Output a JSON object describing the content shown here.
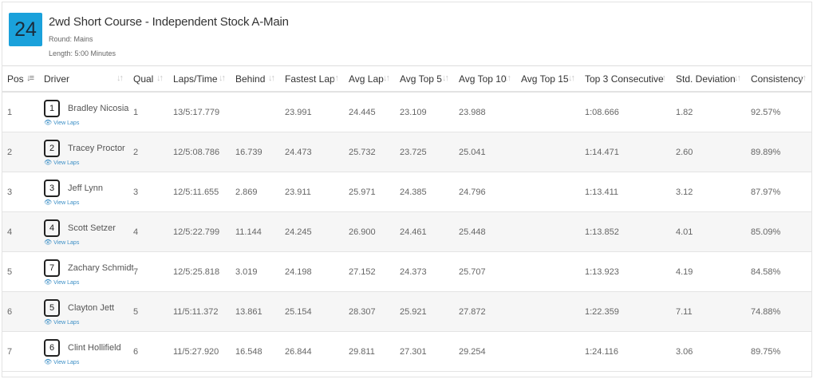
{
  "race": {
    "heat_number": "24",
    "title": "2wd Short Course - Independent Stock A-Main",
    "round": "Round: Mains",
    "length": "Length: 5:00 Minutes"
  },
  "columns": [
    "Pos",
    "Driver",
    "Qual",
    "Laps/Time",
    "Behind",
    "Fastest Lap",
    "Avg Lap",
    "Avg Top 5",
    "Avg Top 10",
    "Avg Top 15",
    "Top 3 Consecutive",
    "Std. Deviation",
    "Consistency"
  ],
  "view_laps_label": "View Laps",
  "rows": [
    {
      "pos": "1",
      "car": "1",
      "driver": "Bradley Nicosia",
      "qual": "1",
      "laps_time": "13/5:17.779",
      "behind": "",
      "fastest": "23.991",
      "avg": "24.445",
      "top5": "23.109",
      "top10": "23.988",
      "top15": "",
      "top3c": "1:08.666",
      "stddev": "1.82",
      "consistency": "92.57%"
    },
    {
      "pos": "2",
      "car": "2",
      "driver": "Tracey Proctor",
      "qual": "2",
      "laps_time": "12/5:08.786",
      "behind": "16.739",
      "fastest": "24.473",
      "avg": "25.732",
      "top5": "23.725",
      "top10": "25.041",
      "top15": "",
      "top3c": "1:14.471",
      "stddev": "2.60",
      "consistency": "89.89%"
    },
    {
      "pos": "3",
      "car": "3",
      "driver": "Jeff Lynn",
      "qual": "3",
      "laps_time": "12/5:11.655",
      "behind": "2.869",
      "fastest": "23.911",
      "avg": "25.971",
      "top5": "24.385",
      "top10": "24.796",
      "top15": "",
      "top3c": "1:13.411",
      "stddev": "3.12",
      "consistency": "87.97%"
    },
    {
      "pos": "4",
      "car": "4",
      "driver": "Scott Setzer",
      "qual": "4",
      "laps_time": "12/5:22.799",
      "behind": "11.144",
      "fastest": "24.245",
      "avg": "26.900",
      "top5": "24.461",
      "top10": "25.448",
      "top15": "",
      "top3c": "1:13.852",
      "stddev": "4.01",
      "consistency": "85.09%"
    },
    {
      "pos": "5",
      "car": "7",
      "driver": "Zachary Schmidt",
      "qual": "7",
      "laps_time": "12/5:25.818",
      "behind": "3.019",
      "fastest": "24.198",
      "avg": "27.152",
      "top5": "24.373",
      "top10": "25.707",
      "top15": "",
      "top3c": "1:13.923",
      "stddev": "4.19",
      "consistency": "84.58%"
    },
    {
      "pos": "6",
      "car": "5",
      "driver": "Clayton Jett",
      "qual": "5",
      "laps_time": "11/5:11.372",
      "behind": "13.861",
      "fastest": "25.154",
      "avg": "28.307",
      "top5": "25.921",
      "top10": "27.872",
      "top15": "",
      "top3c": "1:22.359",
      "stddev": "7.11",
      "consistency": "74.88%"
    },
    {
      "pos": "7",
      "car": "6",
      "driver": "Clint Hollifield",
      "qual": "6",
      "laps_time": "11/5:27.920",
      "behind": "16.548",
      "fastest": "26.844",
      "avg": "29.811",
      "top5": "27.301",
      "top10": "29.254",
      "top15": "",
      "top3c": "1:24.116",
      "stddev": "3.06",
      "consistency": "89.75%"
    }
  ],
  "colors": {
    "badge": "#1aa1db",
    "link": "#3a8ec6",
    "stripe": "#f6f6f6"
  },
  "icons": {
    "sort_active": "sort-numeric-asc-icon",
    "sort": "sort-both-icon",
    "view_laps": "eye-icon"
  }
}
